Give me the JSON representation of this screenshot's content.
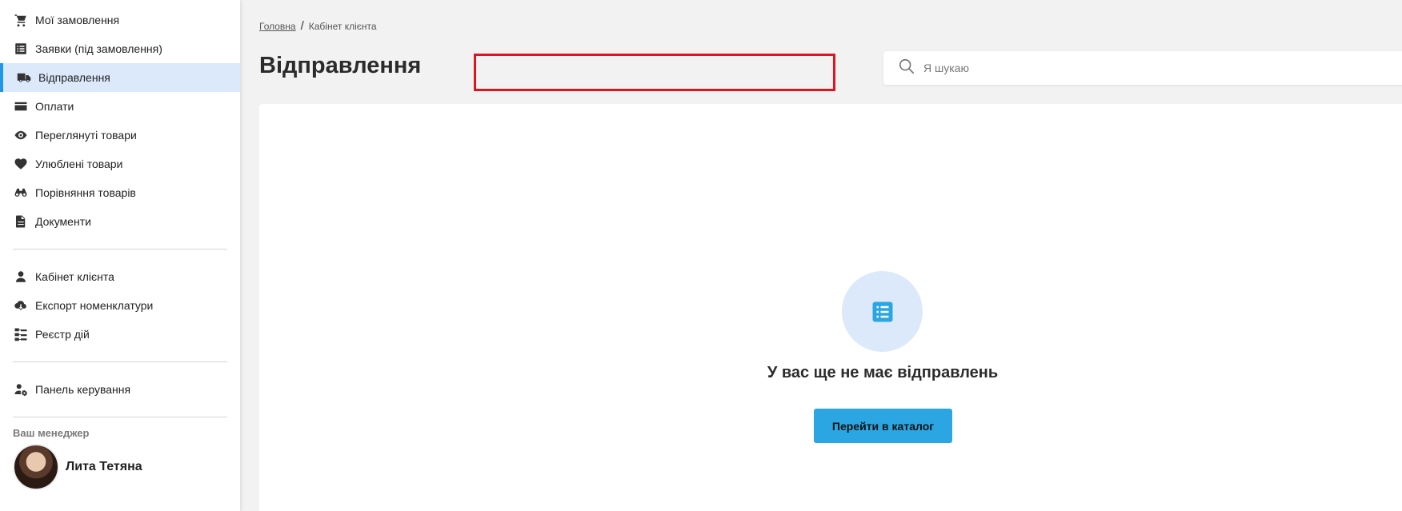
{
  "sidebar": {
    "group1": [
      {
        "label": "Мої замовлення",
        "icon": "cart-icon"
      },
      {
        "label": "Заявки (під замовлення)",
        "icon": "list-icon"
      },
      {
        "label": "Відправлення",
        "icon": "truck-icon",
        "active": true
      },
      {
        "label": "Оплати",
        "icon": "credit-card-icon"
      },
      {
        "label": "Переглянуті товари",
        "icon": "eye-icon"
      },
      {
        "label": "Улюблені товари",
        "icon": "heart-icon"
      },
      {
        "label": "Порівняння товарів",
        "icon": "binoculars-icon"
      },
      {
        "label": "Документи",
        "icon": "document-icon"
      }
    ],
    "group2": [
      {
        "label": "Кабінет клієнта",
        "icon": "user-icon"
      },
      {
        "label": "Експорт номенклатури",
        "icon": "cloud-download-icon"
      },
      {
        "label": "Реєстр дій",
        "icon": "sitemap-icon"
      }
    ],
    "group3": [
      {
        "label": "Панель керування",
        "icon": "user-cog-icon"
      }
    ],
    "manager": {
      "title": "Ваш менеджер",
      "name": "Лита Тетяна"
    }
  },
  "breadcrumb": {
    "home": "Головна",
    "separator": "/",
    "current": "Кабінет клієнта"
  },
  "page": {
    "title": "Відправлення"
  },
  "search": {
    "placeholder": "Я шукаю",
    "value": ""
  },
  "empty_state": {
    "icon": "list-icon",
    "message": "У вас ще не має відправлень",
    "button_label": "Перейти в каталог"
  },
  "colors": {
    "accent": "#2ba6e3",
    "active_bg": "#dce9fb",
    "active_bar": "#1f97e6",
    "highlight_border": "#e0141e",
    "background": "#f2f2f2"
  }
}
